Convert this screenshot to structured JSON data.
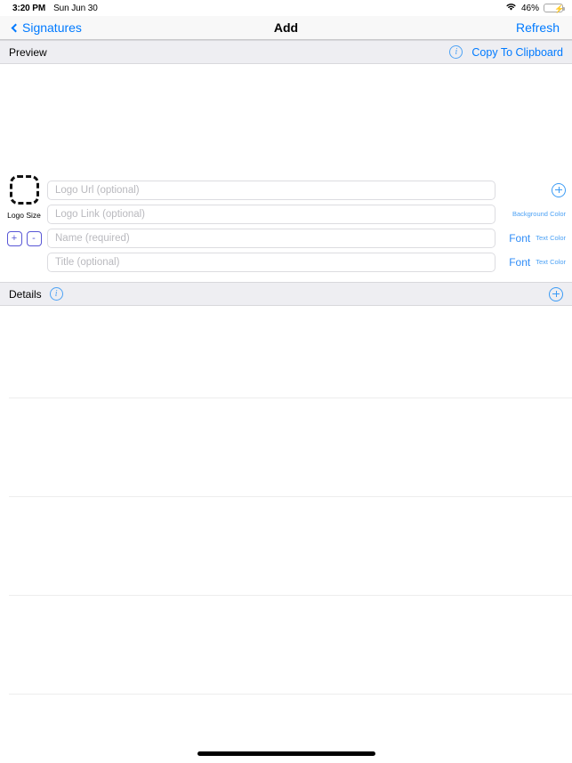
{
  "status_bar": {
    "time": "3:20 PM",
    "date": "Sun Jun 30",
    "wifi_icon": "wifi-icon",
    "battery_percent": "46%",
    "battery_icon": "battery-charging-icon"
  },
  "nav_bar": {
    "back_label": "Signatures",
    "back_icon": "chevron-left-icon",
    "title": "Add",
    "right_action_label": "Refresh"
  },
  "preview_section": {
    "title": "Preview",
    "info_icon": "info-circle-icon",
    "copy_label": "Copy To Clipboard"
  },
  "logo": {
    "placeholder_icon": "logo-dashed-placeholder-icon",
    "size_label": "Logo Size",
    "increase_label": "+",
    "decrease_label": "-"
  },
  "fields": [
    {
      "name": "logo-url",
      "placeholder": "Logo Url (optional)",
      "value": "",
      "side": {
        "type": "plus",
        "icon": "plus-circle-icon"
      }
    },
    {
      "name": "logo-link",
      "placeholder": "Logo Link (optional)",
      "value": "",
      "side": {
        "type": "link",
        "label": "Background Color"
      }
    },
    {
      "name": "name",
      "placeholder": "Name (required)",
      "value": "",
      "side": {
        "type": "font-color",
        "font_label": "Font",
        "color_label": "Text Color"
      }
    },
    {
      "name": "title",
      "placeholder": "Title (optional)",
      "value": "",
      "side": {
        "type": "font-color",
        "font_label": "Font",
        "color_label": "Text Color"
      }
    }
  ],
  "details_section": {
    "title": "Details",
    "info_icon": "info-circle-icon",
    "add_icon": "plus-circle-icon"
  },
  "details_rows": [
    "",
    "",
    "",
    ""
  ],
  "colors": {
    "accent_blue": "#007aff",
    "link_blue": "#4da2f5",
    "purple": "#5856d6",
    "section_bg": "#eeeef2",
    "nav_bg": "#f8f8f8",
    "separator": "#ededed",
    "battery_green": "#37c83c"
  }
}
